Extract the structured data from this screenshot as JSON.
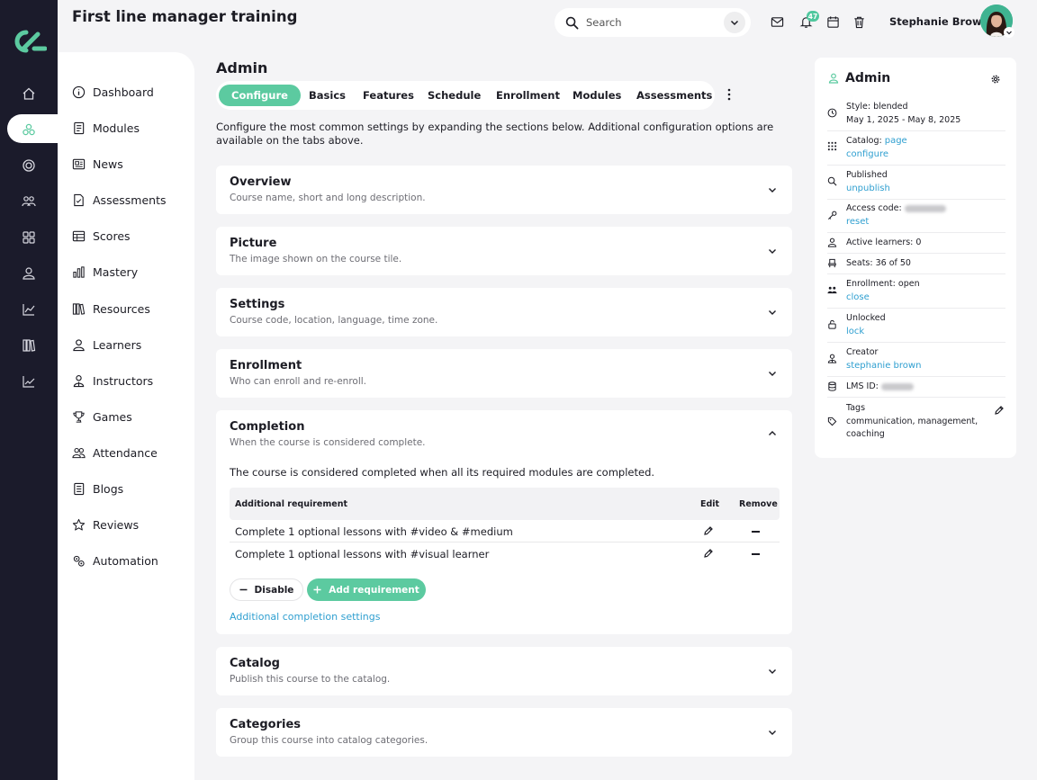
{
  "header": {
    "course_title": "First line manager training",
    "search_placeholder": "Search",
    "notification_count": "47",
    "user_name": "Stephanie Brown"
  },
  "colors": {
    "accent": "#5ccaa0",
    "rail": "#1b1b2b",
    "link": "#2f9fd0"
  },
  "rail_icons": [
    "home-icon",
    "modules-icon",
    "target-icon",
    "people-icon",
    "grid-icon",
    "person-icon",
    "chart-icon",
    "library-icon",
    "trend-icon"
  ],
  "nav": {
    "items": [
      {
        "label": "Dashboard",
        "icon": "info-icon"
      },
      {
        "label": "Modules",
        "icon": "book-icon"
      },
      {
        "label": "News",
        "icon": "newspaper-icon"
      },
      {
        "label": "Assessments",
        "icon": "document-icon"
      },
      {
        "label": "Scores",
        "icon": "table-icon"
      },
      {
        "label": "Mastery",
        "icon": "bars-icon"
      },
      {
        "label": "Resources",
        "icon": "library-icon"
      },
      {
        "label": "Learners",
        "icon": "person-icon"
      },
      {
        "label": "Instructors",
        "icon": "instructor-icon"
      },
      {
        "label": "Games",
        "icon": "trophy-icon"
      },
      {
        "label": "Attendance",
        "icon": "group-icon"
      },
      {
        "label": "Blogs",
        "icon": "blog-icon"
      },
      {
        "label": "Reviews",
        "icon": "star-icon"
      },
      {
        "label": "Automation",
        "icon": "gears-icon"
      }
    ]
  },
  "main": {
    "title": "Admin",
    "tabs": [
      "Configure",
      "Basics",
      "Features",
      "Schedule",
      "Enrollment",
      "Modules",
      "Assessments"
    ],
    "intro": "Configure the most common settings by expanding the sections below. Additional configuration options are available on the tabs above.",
    "sections": [
      {
        "title": "Overview",
        "subtitle": "Course name, short and long description."
      },
      {
        "title": "Picture",
        "subtitle": "The image shown on the course tile."
      },
      {
        "title": "Settings",
        "subtitle": "Course code, location, language, time zone."
      },
      {
        "title": "Enrollment",
        "subtitle": "Who can enroll and re-enroll."
      },
      {
        "title": "Completion",
        "subtitle": "When the course is considered complete."
      },
      {
        "title": "Catalog",
        "subtitle": "Publish this course to the catalog."
      },
      {
        "title": "Categories",
        "subtitle": "Group this course into catalog categories."
      }
    ],
    "completion": {
      "description": "The course is considered completed when all its required modules are completed.",
      "columns": [
        "Additional requirement",
        "Edit",
        "Remove"
      ],
      "rows": [
        "Complete 1 optional lessons with #video & #medium",
        "Complete 1 optional lessons with #visual learner"
      ],
      "disable_label": "Disable",
      "add_label": "Add requirement",
      "more_link": "Additional completion settings"
    }
  },
  "side": {
    "title": "Admin",
    "style_label": "Style: blended",
    "dates": "May 1, 2025 - May 8, 2025",
    "catalog_label": "Catalog:",
    "catalog_link1": "page",
    "catalog_link2": "configure",
    "published_label": "Published",
    "published_link": "unpublish",
    "access_label": "Access code:",
    "access_link": "reset",
    "active_learners": "Active learners: 0",
    "seats": "Seats: 36 of 50",
    "enrollment_label": "Enrollment: open",
    "enrollment_link": "close",
    "unlocked_label": "Unlocked",
    "unlocked_link": "lock",
    "creator_label": "Creator",
    "creator_link": "stephanie brown",
    "lms_label": "LMS ID:",
    "tags_label": "Tags",
    "tags": "communication, management, coaching"
  }
}
